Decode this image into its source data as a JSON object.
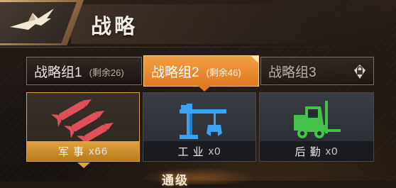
{
  "header": {
    "title": "战略",
    "emblem_icon": "eagle-emblem-icon"
  },
  "tabs": [
    {
      "name": "战略组1",
      "remaining": "(剩余26)",
      "selected": false
    },
    {
      "name": "战略组2",
      "remaining": "(剩余46)",
      "selected": true
    },
    {
      "name": "战略组3",
      "locked": true,
      "icon": "lock-icon"
    }
  ],
  "cards": [
    {
      "name": "军 事",
      "count": "x66",
      "icon": "missiles-icon",
      "color": "#e0505a",
      "selected": true
    },
    {
      "name": "工 业",
      "count": "x0",
      "icon": "crane-icon",
      "color": "#3aa2f0",
      "selected": false
    },
    {
      "name": "后 勤",
      "count": "x0",
      "icon": "forklift-icon",
      "color": "#45c04a",
      "selected": false
    }
  ],
  "footer": {
    "partial_title": "通级"
  },
  "colors": {
    "accent": "#e07a22",
    "selected_card": "#d8a341"
  }
}
